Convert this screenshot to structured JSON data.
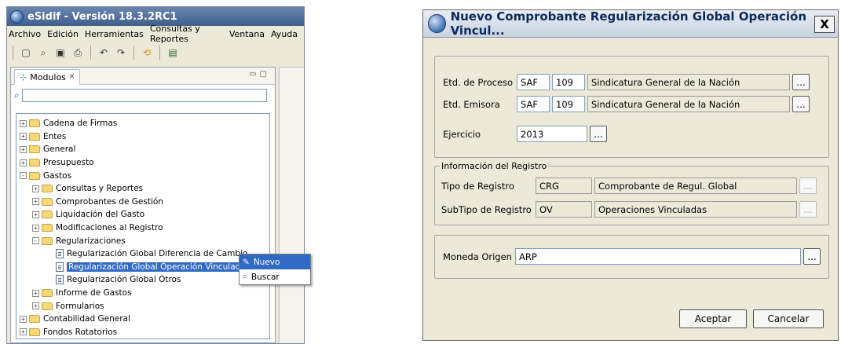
{
  "app": {
    "title": "eSidif - Versión 18.3.2RC1",
    "menu": [
      "Archivo",
      "Edición",
      "Herramientas",
      "Consultas y Reportes",
      "Ventana",
      "Ayuda"
    ],
    "modules_tab": "Modulos",
    "search_value": "",
    "tree": [
      {
        "label": "Cadena de Firmas",
        "level": 0,
        "kind": "folder",
        "exp": "+"
      },
      {
        "label": "Entes",
        "level": 0,
        "kind": "folder",
        "exp": "+"
      },
      {
        "label": "General",
        "level": 0,
        "kind": "folder",
        "exp": "+"
      },
      {
        "label": "Presupuesto",
        "level": 0,
        "kind": "folder",
        "exp": "+"
      },
      {
        "label": "Gastos",
        "level": 0,
        "kind": "folder",
        "exp": "-"
      },
      {
        "label": "Consultas y Reportes",
        "level": 1,
        "kind": "folder",
        "exp": "+"
      },
      {
        "label": "Comprobantes de Gestión",
        "level": 1,
        "kind": "folder",
        "exp": "+"
      },
      {
        "label": "Liquidación del Gasto",
        "level": 1,
        "kind": "folder",
        "exp": "+"
      },
      {
        "label": "Modificaciones al Registro",
        "level": 1,
        "kind": "folder",
        "exp": "+"
      },
      {
        "label": "Regularizaciones",
        "level": 1,
        "kind": "folder",
        "exp": "-"
      },
      {
        "label": "Regularización Global Diferencia de Cambio",
        "level": 2,
        "kind": "doc"
      },
      {
        "label": "Regularización Global Operación Vinculada",
        "level": 2,
        "kind": "doc",
        "selected": true
      },
      {
        "label": "Regularización Global Otros",
        "level": 2,
        "kind": "doc"
      },
      {
        "label": "Informe de Gastos",
        "level": 1,
        "kind": "folder",
        "exp": "+"
      },
      {
        "label": "Formularios",
        "level": 1,
        "kind": "folder",
        "exp": "+"
      },
      {
        "label": "Contabilidad General",
        "level": 0,
        "kind": "folder",
        "exp": "+"
      },
      {
        "label": "Fondos Rotatorios",
        "level": 0,
        "kind": "folder",
        "exp": "+"
      }
    ],
    "context_menu": [
      "Nuevo",
      "Buscar"
    ]
  },
  "dialog": {
    "title": "Nuevo Comprobante Regularización Global Operación Vincul...",
    "close": "X",
    "etd_proceso": {
      "label": "Etd. de Proceso",
      "type": "SAF",
      "code": "109",
      "name": "Sindicatura General de la Nación"
    },
    "etd_emisora": {
      "label": "Etd. Emisora",
      "type": "SAF",
      "code": "109",
      "name": "Sindicatura General de la Nación"
    },
    "ejercicio": {
      "label": "Ejercicio",
      "value": "2013"
    },
    "info_legend": "Información del Registro",
    "tipo_registro": {
      "label": "Tipo de Registro",
      "code": "CRG",
      "name": "Comprobante de Regul. Global"
    },
    "subtipo_registro": {
      "label": "SubTipo de Registro",
      "code": "OV",
      "name": "Operaciones Vinculadas"
    },
    "moneda": {
      "label": "Moneda Origen",
      "value": "ARP"
    },
    "dots": "...",
    "accept": "Aceptar",
    "cancel": "Cancelar"
  }
}
